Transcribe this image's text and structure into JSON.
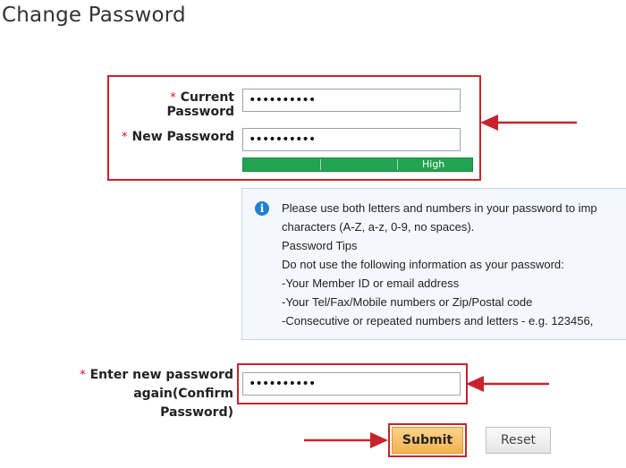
{
  "page": {
    "title": "Change Password"
  },
  "form": {
    "required_marker": "*",
    "current_password": {
      "label": "Current Password",
      "value": "••••••••••"
    },
    "new_password": {
      "label": "New Password",
      "value": "••••••••••"
    },
    "strength": {
      "label": "High"
    },
    "confirm_password": {
      "label_line1": "Enter new password again(Confirm",
      "label_line2": "Password)",
      "value": "••••••••••"
    }
  },
  "tips": {
    "icon": "info-icon",
    "lines": [
      "Please use both letters and numbers in your password to imp",
      "characters (A-Z, a-z, 0-9, no spaces).",
      "Password Tips",
      "Do not use the following information as your password:",
      "-Your Member ID or email address",
      "-Your Tel/Fax/Mobile numbers or Zip/Postal code",
      "-Consecutive or repeated numbers and letters - e.g. 123456,"
    ]
  },
  "buttons": {
    "submit": "Submit",
    "reset": "Reset"
  },
  "colors": {
    "highlight": "#c8232c",
    "strength_high": "#22a351",
    "submit": "#f4b24d",
    "info": "#1f7fd1"
  }
}
